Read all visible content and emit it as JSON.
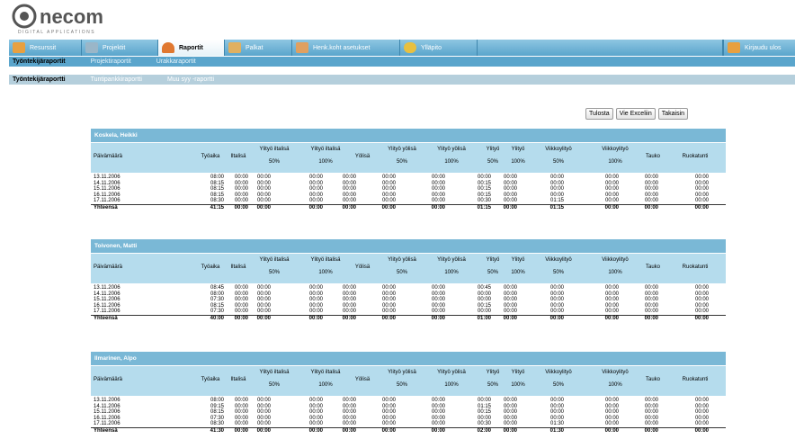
{
  "app": {
    "logo_text": "necom",
    "logo_tagline": "DIGITAL APPLICATIONS"
  },
  "nav": {
    "items": [
      {
        "label": "Resurssit",
        "icon": "people-icon",
        "icon_color": "#e8a040"
      },
      {
        "label": "Projektit",
        "icon": "projects-icon",
        "icon_color": "#9ab6c8"
      },
      {
        "label": "Raportit",
        "icon": "reports-icon",
        "icon_color": "#e07830",
        "active": true
      },
      {
        "label": "Palkat",
        "icon": "salary-icon",
        "icon_color": "#e0b060"
      },
      {
        "label": "Henk.koht asetukset",
        "icon": "personal-settings-icon",
        "icon_color": "#e0a060"
      },
      {
        "label": "Ylläpito",
        "icon": "admin-icon",
        "icon_color": "#e8c040"
      }
    ],
    "logout_label": "Kirjaudu ulos"
  },
  "subnav1": {
    "items": [
      {
        "label": "Työntekijäraportit",
        "active": true
      },
      {
        "label": "Projektiraportit"
      },
      {
        "label": "Urakkaraportit"
      }
    ]
  },
  "subnav2": {
    "items": [
      {
        "label": "Työntekijäraportti",
        "active": true
      },
      {
        "label": "Tuntipankkiraportti"
      },
      {
        "label": "Muu syy -raportti"
      }
    ]
  },
  "actions": {
    "print": "Tulosta",
    "export": "Vie Exceliin",
    "back": "Takaisin"
  },
  "columns": {
    "date": "Päivämäärä",
    "work": "Työaika",
    "evening": "Iltalisä",
    "ot_evening_50_top": "Ylityö iltalisä",
    "ot_evening_50_bottom": "50%",
    "ot_evening_100_top": "Ylityö iltalisä",
    "ot_evening_100_bottom": "100%",
    "night": "Yölisä",
    "ot_night_50_top": "Ylityö yölisä",
    "ot_night_50_bottom": "50%",
    "ot_night_100_top": "Ylityö yölisä",
    "ot_night_100_bottom": "100%",
    "ot_50_top": "Ylityö",
    "ot_50_bottom": "50%",
    "ot_100_top": "Ylityö",
    "ot_100_bottom": "100%",
    "weekly_50_top": "Viikkoylityö",
    "weekly_50_bottom": "50%",
    "weekly_100_top": "Viikkoylityö",
    "weekly_100_bottom": "100%",
    "break": "Tauko",
    "lunch": "Ruokatunti"
  },
  "employees": [
    {
      "name": "Koskela, Heikki",
      "rows": [
        [
          "13.11.2006",
          "08:00",
          "00:00",
          "00:00",
          "00:00",
          "00:00",
          "00:00",
          "00:00",
          "00:00",
          "00:00",
          "00:00",
          "00:00",
          "00:00",
          "00:00"
        ],
        [
          "14.11.2006",
          "08:15",
          "00:00",
          "00:00",
          "00:00",
          "00:00",
          "00:00",
          "00:00",
          "00:15",
          "00:00",
          "00:00",
          "00:00",
          "00:00",
          "00:00"
        ],
        [
          "15.11.2006",
          "08:15",
          "00:00",
          "00:00",
          "00:00",
          "00:00",
          "00:00",
          "00:00",
          "00:15",
          "00:00",
          "00:00",
          "00:00",
          "00:00",
          "00:00"
        ],
        [
          "16.11.2006",
          "08:15",
          "00:00",
          "00:00",
          "00:00",
          "00:00",
          "00:00",
          "00:00",
          "00:15",
          "00:00",
          "00:00",
          "00:00",
          "00:00",
          "00:00"
        ],
        [
          "17.11.2006",
          "08:30",
          "00:00",
          "00:00",
          "00:00",
          "00:00",
          "00:00",
          "00:00",
          "00:30",
          "00:00",
          "01:15",
          "00:00",
          "00:00",
          "00:00"
        ]
      ],
      "total": [
        "Yhteensä",
        "41:15",
        "00:00",
        "00:00",
        "00:00",
        "00:00",
        "00:00",
        "00:00",
        "01:15",
        "00:00",
        "01:15",
        "00:00",
        "00:00",
        "00:00"
      ]
    },
    {
      "name": "Toivonen, Matti",
      "rows": [
        [
          "13.11.2006",
          "08:45",
          "00:00",
          "00:00",
          "00:00",
          "00:00",
          "00:00",
          "00:00",
          "00:45",
          "00:00",
          "00:00",
          "00:00",
          "00:00",
          "00:00"
        ],
        [
          "14.11.2006",
          "08:00",
          "00:00",
          "00:00",
          "00:00",
          "00:00",
          "00:00",
          "00:00",
          "00:00",
          "00:00",
          "00:00",
          "00:00",
          "00:00",
          "00:00"
        ],
        [
          "15.11.2006",
          "07:30",
          "00:00",
          "00:00",
          "00:00",
          "00:00",
          "00:00",
          "00:00",
          "00:00",
          "00:00",
          "00:00",
          "00:00",
          "00:00",
          "00:00"
        ],
        [
          "16.11.2006",
          "08:15",
          "00:00",
          "00:00",
          "00:00",
          "00:00",
          "00:00",
          "00:00",
          "00:15",
          "00:00",
          "00:00",
          "00:00",
          "00:00",
          "00:00"
        ],
        [
          "17.11.2006",
          "07:30",
          "00:00",
          "00:00",
          "00:00",
          "00:00",
          "00:00",
          "00:00",
          "00:00",
          "00:00",
          "00:00",
          "00:00",
          "00:00",
          "00:00"
        ]
      ],
      "total": [
        "Yhteensä",
        "40:00",
        "00:00",
        "00:00",
        "00:00",
        "00:00",
        "00:00",
        "00:00",
        "01:00",
        "00:00",
        "00:00",
        "00:00",
        "00:00",
        "00:00"
      ]
    },
    {
      "name": "Ilmarinen, Alpo",
      "rows": [
        [
          "13.11.2006",
          "08:00",
          "00:00",
          "00:00",
          "00:00",
          "00:00",
          "00:00",
          "00:00",
          "00:00",
          "00:00",
          "00:00",
          "00:00",
          "00:00",
          "00:00"
        ],
        [
          "14.11.2006",
          "09:15",
          "00:00",
          "00:00",
          "00:00",
          "00:00",
          "00:00",
          "00:00",
          "01:15",
          "00:00",
          "00:00",
          "00:00",
          "00:00",
          "00:00"
        ],
        [
          "15.11.2006",
          "08:15",
          "00:00",
          "00:00",
          "00:00",
          "00:00",
          "00:00",
          "00:00",
          "00:15",
          "00:00",
          "00:00",
          "00:00",
          "00:00",
          "00:00"
        ],
        [
          "16.11.2006",
          "07:30",
          "00:00",
          "00:00",
          "00:00",
          "00:00",
          "00:00",
          "00:00",
          "00:00",
          "00:00",
          "00:00",
          "00:00",
          "00:00",
          "00:00"
        ],
        [
          "17.11.2006",
          "08:30",
          "00:00",
          "00:00",
          "00:00",
          "00:00",
          "00:00",
          "00:00",
          "00:30",
          "00:00",
          "01:30",
          "00:00",
          "00:00",
          "00:00"
        ]
      ],
      "total": [
        "Yhteensä",
        "41:30",
        "00:00",
        "00:00",
        "00:00",
        "00:00",
        "00:00",
        "00:00",
        "02:00",
        "00:00",
        "01:30",
        "00:00",
        "00:00",
        "00:00"
      ]
    }
  ]
}
